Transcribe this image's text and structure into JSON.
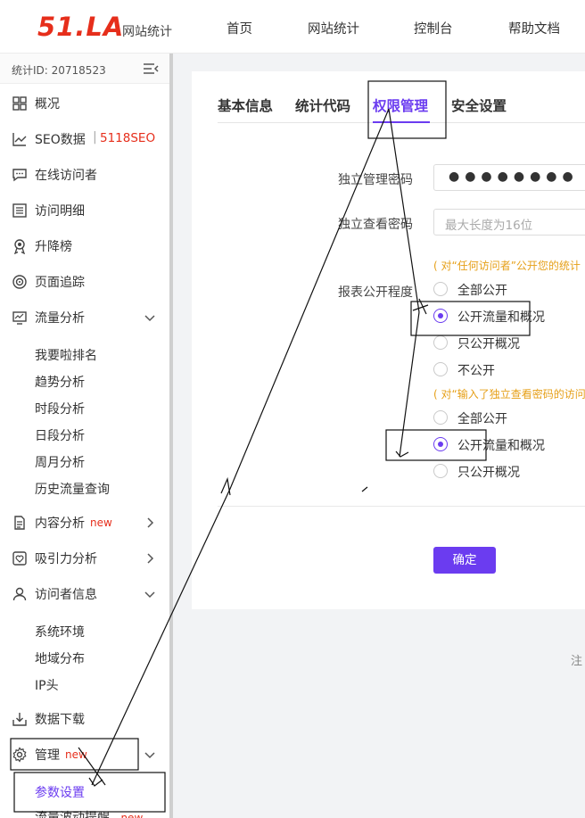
{
  "header": {
    "logo_text": "51.LA",
    "logo_sub": "网站统计",
    "nav": [
      "首页",
      "网站统计",
      "控制台",
      "帮助文档"
    ]
  },
  "sidebar": {
    "stat_id": "统计ID: 20718523",
    "items": [
      {
        "label": "概况",
        "icon": "grid-icon"
      },
      {
        "label": "SEO数据",
        "icon": "trend-icon",
        "extra": "5118SEO"
      },
      {
        "label": "在线访问者",
        "icon": "chat-icon"
      },
      {
        "label": "访问明细",
        "icon": "list-icon"
      },
      {
        "label": "升降榜",
        "icon": "medal-icon"
      },
      {
        "label": "页面追踪",
        "icon": "target-icon"
      },
      {
        "label": "流量分析",
        "icon": "monitor-icon"
      },
      {
        "label": "内容分析",
        "icon": "doc-icon",
        "badge": "new"
      },
      {
        "label": "吸引力分析",
        "icon": "heart-icon"
      },
      {
        "label": "访问者信息",
        "icon": "user-icon"
      },
      {
        "label": "数据下载",
        "icon": "download-icon"
      },
      {
        "label": "管理",
        "icon": "gear-icon",
        "badge": "new"
      }
    ],
    "traffic_sub": [
      "我要啦排名",
      "趋势分析",
      "时段分析",
      "日段分析",
      "周月分析",
      "历史流量查询"
    ],
    "visitor_sub": [
      "系统环境",
      "地域分布",
      "IP头"
    ],
    "manage_sub": [
      "参数设置",
      "流量波动提醒"
    ],
    "manage_sub_badge": "new"
  },
  "tabs": [
    "基本信息",
    "统计代码",
    "权限管理",
    "安全设置"
  ],
  "form": {
    "admin_pwd_label": "独立管理密码",
    "admin_pwd_value": "●●●●●●●●",
    "view_pwd_label": "独立查看密码",
    "view_pwd_placeholder": "最大长度为16位",
    "report_label": "报表公开程度",
    "hint_any": "( 对“任何访问者”公开您的统计",
    "hint_pwd": "( 对“输入了独立查看密码的访问",
    "options_any": [
      "全部公开",
      "公开流量和概况",
      "只公开概况",
      "不公开"
    ],
    "options_pwd": [
      "全部公开",
      "公开流量和概况",
      "只公开概况"
    ],
    "selected_any": 1,
    "selected_pwd": 1,
    "confirm": "确定"
  },
  "footer_char": "注",
  "colors": {
    "accent": "#6b3cf0",
    "logo": "#e62e1b",
    "hint": "#e6a019"
  }
}
